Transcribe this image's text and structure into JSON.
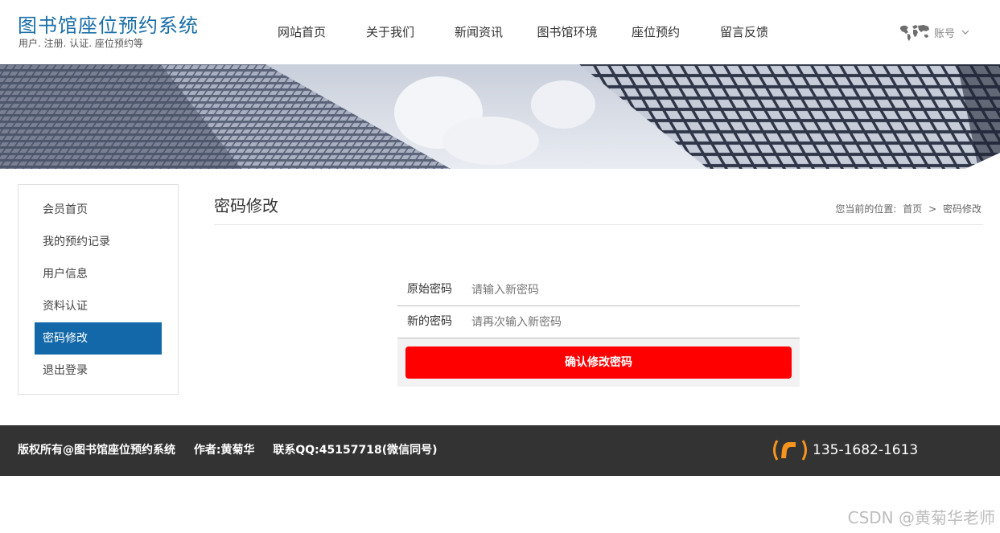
{
  "header": {
    "title": "图书馆座位预约系统",
    "subtitle": "用户. 注册. 认证. 座位预约等",
    "nav": [
      "网站首页",
      "关于我们",
      "新闻资讯",
      "图书馆环境",
      "座位预约",
      "留言反馈"
    ],
    "account_label": "账号",
    "account_icon": "world-map-icon"
  },
  "sidebar": {
    "items": [
      "会员首页",
      "我的预约记录",
      "用户信息",
      "资料认证",
      "密码修改",
      "退出登录"
    ],
    "active_index": 4
  },
  "main": {
    "title": "密码修改",
    "breadcrumb": {
      "prefix": "您当前的位置:",
      "home": "首页",
      "separator": ">",
      "current": "密码修改"
    }
  },
  "form": {
    "old_password_label": "原始密码",
    "old_password_placeholder": "请输入新密码",
    "new_password_label": "新的密码",
    "new_password_placeholder": "请再次输入新密码",
    "submit_label": "确认修改密码"
  },
  "footer": {
    "copyright": "版权所有@图书馆座位预约系统",
    "author": "作者:黄菊华",
    "contact": "联系QQ:45157718(微信同号)",
    "phone": "135-1682-1613"
  },
  "watermark": "CSDN @黄菊华老师",
  "colors": {
    "brand_title": "#1a6ea8",
    "sidebar_active": "#1268a8",
    "submit_button": "#ff0000",
    "footer_bg": "#333333",
    "phone_icon": "#f7941d"
  }
}
